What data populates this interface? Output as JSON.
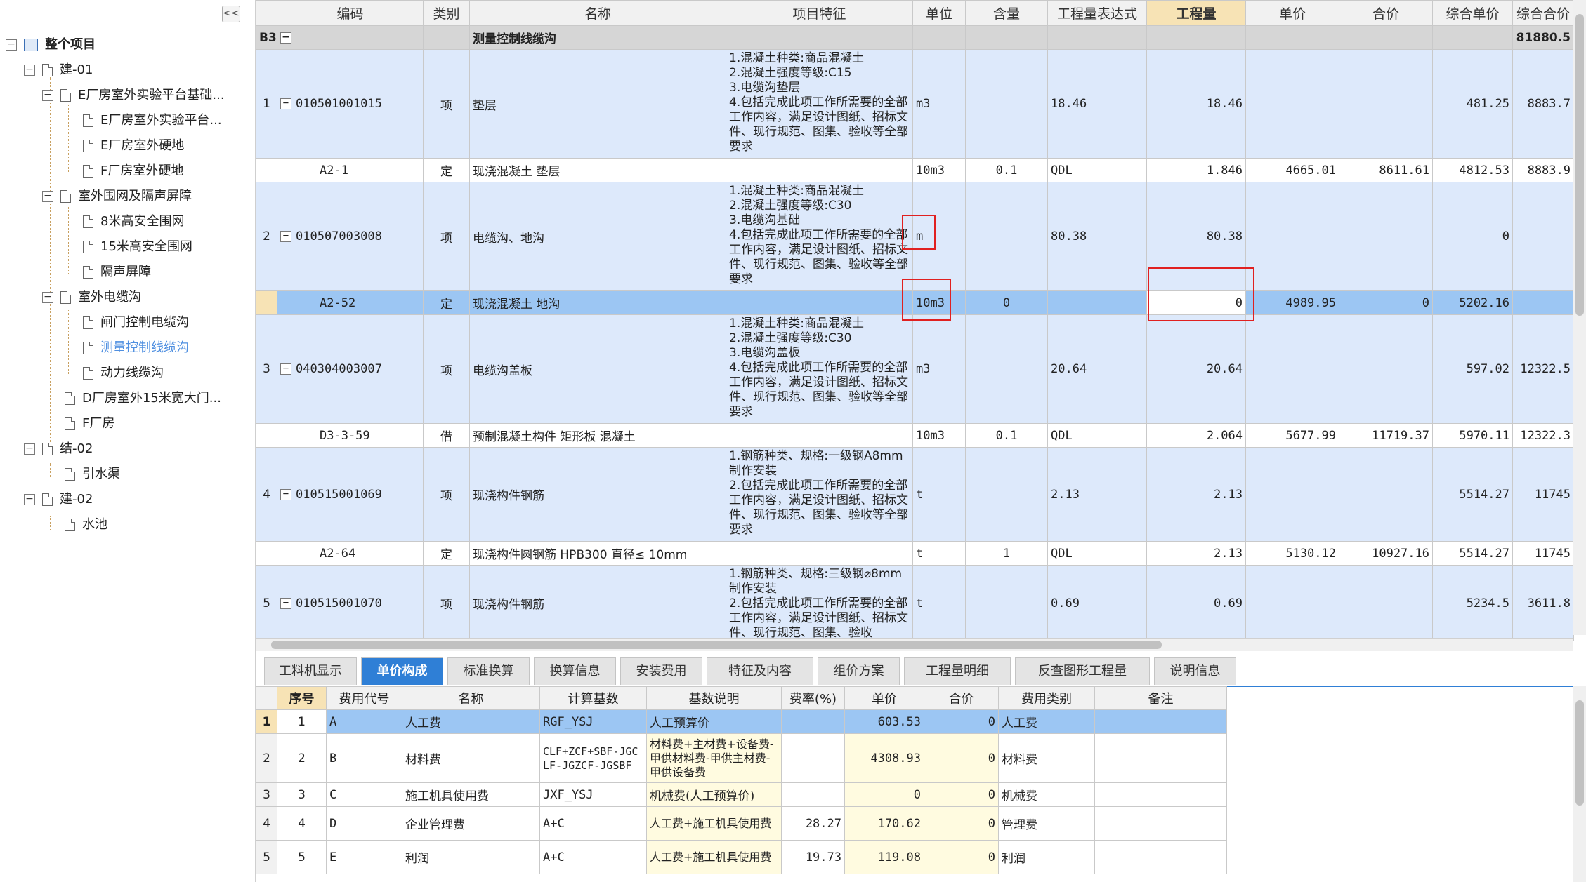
{
  "tree": {
    "collapse_label": "<<",
    "nodes": [
      {
        "label": "整个项目",
        "toggle": "−"
      },
      {
        "label": "建-01",
        "toggle": "−"
      },
      {
        "label": "E厂房室外实验平台基础...",
        "toggle": "−"
      },
      {
        "label": "E厂房室外实验平台..."
      },
      {
        "label": "E厂房室外硬地"
      },
      {
        "label": "F厂房室外硬地"
      },
      {
        "label": "室外围网及隔声屏障",
        "toggle": "−"
      },
      {
        "label": "8米高安全围网"
      },
      {
        "label": "15米高安全围网"
      },
      {
        "label": "隔声屏障"
      },
      {
        "label": "室外电缆沟",
        "toggle": "−"
      },
      {
        "label": "闸门控制电缆沟"
      },
      {
        "label": "测量控制线缆沟"
      },
      {
        "label": "动力线缆沟"
      },
      {
        "label": "D厂房室外15米宽大门..."
      },
      {
        "label": "F厂房"
      },
      {
        "label": "结-02",
        "toggle": "−"
      },
      {
        "label": "引水渠"
      },
      {
        "label": "建-02",
        "toggle": "−"
      },
      {
        "label": "水池"
      }
    ],
    "selected_color": "#2f7fd6"
  },
  "grid": {
    "headers": [
      "编码",
      "类别",
      "名称",
      "项目特征",
      "单位",
      "含量",
      "工程量表达式",
      "工程量",
      "单价",
      "合价",
      "综合单价",
      "综合合价"
    ],
    "group": {
      "id": "B3",
      "toggle": "−",
      "name": "测量控制线缆沟",
      "total": "81880.5"
    },
    "rows": [
      {
        "num": "1",
        "code": "010501001015",
        "type": "项",
        "name": "垫层",
        "feature": "1.混凝土种类:商品混凝土\n2.混凝土强度等级:C15\n3.电缆沟垫层\n4.包括完成此项工作所需要的全部工作内容，满足设计图纸、招标文件、现行规范、图集、验收等全部要求",
        "unit": "m3",
        "content": "",
        "expr": "18.46",
        "qty": "18.46",
        "price": "",
        "total": "",
        "comp_price": "481.25",
        "comp_total": "8883.7"
      },
      {
        "num": "",
        "code": "A2-1",
        "type": "定",
        "name": "现浇混凝土 垫层",
        "feature": "",
        "unit": "10m3",
        "content": "0.1",
        "expr": "QDL",
        "qty": "1.846",
        "price": "4665.01",
        "total": "8611.61",
        "comp_price": "4812.53",
        "comp_total": "8883.9"
      },
      {
        "num": "2",
        "code": "010507003008",
        "type": "项",
        "name": "电缆沟、地沟",
        "feature": "1.混凝土种类:商品混凝土\n2.混凝土强度等级:C30\n3.电缆沟基础\n4.包括完成此项工作所需要的全部工作内容，满足设计图纸、招标文件、现行规范、图集、验收等全部要求",
        "unit": "m",
        "content": "",
        "expr": "80.38",
        "qty": "80.38",
        "price": "",
        "total": "",
        "comp_price": "0",
        "comp_total": ""
      },
      {
        "num": "",
        "code": "A2-52",
        "type": "定",
        "name": "现浇混凝土 地沟",
        "feature": "",
        "unit": "10m3",
        "content": "0",
        "expr": "",
        "qty": "0",
        "price": "4989.95",
        "total": "0",
        "comp_price": "5202.16",
        "comp_total": ""
      },
      {
        "num": "3",
        "code": "040304003007",
        "type": "项",
        "name": "电缆沟盖板",
        "feature": "1.混凝土种类:商品混凝土\n2.混凝土强度等级:C30\n3.电缆沟盖板\n4.包括完成此项工作所需要的全部工作内容，满足设计图纸、招标文件、现行规范、图集、验收等全部要求",
        "unit": "m3",
        "content": "",
        "expr": "20.64",
        "qty": "20.64",
        "price": "",
        "total": "",
        "comp_price": "597.02",
        "comp_total": "12322.5"
      },
      {
        "num": "",
        "code": "D3-3-59",
        "type": "借",
        "name": "预制混凝土构件 矩形板 混凝土",
        "feature": "",
        "unit": "10m3",
        "content": "0.1",
        "expr": "QDL",
        "qty": "2.064",
        "price": "5677.99",
        "total": "11719.37",
        "comp_price": "5970.11",
        "comp_total": "12322.3"
      },
      {
        "num": "4",
        "code": "010515001069",
        "type": "项",
        "name": "现浇构件钢筋",
        "feature": "1.钢筋种类、规格:一级钢A8mm制作安装\n2.包括完成此项工作所需要的全部工作内容，满足设计图纸、招标文件、现行规范、图集、验收等全部要求",
        "unit": "t",
        "content": "",
        "expr": "2.13",
        "qty": "2.13",
        "price": "",
        "total": "",
        "comp_price": "5514.27",
        "comp_total": "11745"
      },
      {
        "num": "",
        "code": "A2-64",
        "type": "定",
        "name": "现浇构件圆钢筋 HPB300 直径≤ 10mm",
        "feature": "",
        "unit": "t",
        "content": "1",
        "expr": "QDL",
        "qty": "2.13",
        "price": "5130.12",
        "total": "10927.16",
        "comp_price": "5514.27",
        "comp_total": "11745"
      },
      {
        "num": "5",
        "code": "010515001070",
        "type": "项",
        "name": "现浇构件钢筋",
        "feature": "1.钢筋种类、规格:三级钢⌀8mm制作安装\n2.包括完成此项工作所需要的全部工作内容，满足设计图纸、招标文件、现行规范、图集、验收",
        "unit": "t",
        "content": "",
        "expr": "0.69",
        "qty": "0.69",
        "price": "",
        "total": "",
        "comp_price": "5234.5",
        "comp_total": "3611.8"
      }
    ]
  },
  "tabs": [
    "工料机显示",
    "单价构成",
    "标准换算",
    "换算信息",
    "安装费用",
    "特征及内容",
    "组价方案",
    "工程量明细",
    "反查图形工程量",
    "说明信息"
  ],
  "bottom": {
    "headers": [
      "序号",
      "费用代号",
      "名称",
      "计算基数",
      "基数说明",
      "费率(%)",
      "单价",
      "合价",
      "费用类别",
      "备注"
    ],
    "rows": [
      {
        "n": "1",
        "seq": "1",
        "code": "A",
        "name": "人工费",
        "base": "RGF_YSJ",
        "desc": "人工预算价",
        "rate": "",
        "price": "603.53",
        "total": "0",
        "cat": "人工费",
        "note": ""
      },
      {
        "n": "2",
        "seq": "2",
        "code": "B",
        "name": "材料费",
        "base": "CLF+ZCF+SBF-JGCLF-JGZCF-JGSBF",
        "desc": "材料费+主材费+设备费-甲供材料费-甲供主材费-甲供设备费",
        "rate": "",
        "price": "4308.93",
        "total": "0",
        "cat": "材料费",
        "note": ""
      },
      {
        "n": "3",
        "seq": "3",
        "code": "C",
        "name": "施工机具使用费",
        "base": "JXF_YSJ",
        "desc": "机械费(人工预算价)",
        "rate": "",
        "price": "0",
        "total": "0",
        "cat": "机械费",
        "note": ""
      },
      {
        "n": "4",
        "seq": "4",
        "code": "D",
        "name": "企业管理费",
        "base": "A+C",
        "desc": "人工费+施工机具使用费",
        "rate": "28.27",
        "price": "170.62",
        "total": "0",
        "cat": "管理费",
        "note": ""
      },
      {
        "n": "5",
        "seq": "5",
        "code": "E",
        "name": "利润",
        "base": "A+C",
        "desc": "人工费+施工机具使用费",
        "rate": "19.73",
        "price": "119.08",
        "total": "0",
        "cat": "利润",
        "note": ""
      }
    ]
  }
}
